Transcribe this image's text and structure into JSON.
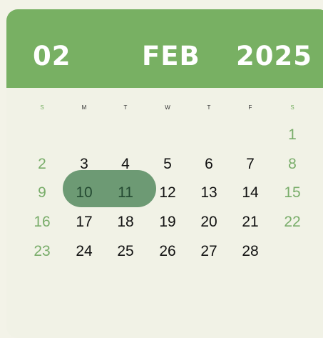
{
  "header": {
    "day": "02",
    "month": "FEB",
    "year": "2025"
  },
  "weekdays": [
    "S",
    "M",
    "T",
    "W",
    "T",
    "F",
    "S"
  ],
  "weeks": [
    [
      "",
      "",
      "",
      "",
      "",
      "",
      "1"
    ],
    [
      "2",
      "3",
      "4",
      "5",
      "6",
      "7",
      "8"
    ],
    [
      "9",
      "10",
      "11",
      "12",
      "13",
      "14",
      "15"
    ],
    [
      "16",
      "17",
      "18",
      "19",
      "20",
      "21",
      "22"
    ],
    [
      "23",
      "24",
      "25",
      "26",
      "27",
      "28",
      ""
    ]
  ],
  "selected_range": [
    "10",
    "11"
  ],
  "colors": {
    "accent": "#78b063",
    "weekend": "#79ad6a",
    "selection": "#6d9a74",
    "selection_text": "#244a32",
    "background": "#f1f2e6"
  }
}
